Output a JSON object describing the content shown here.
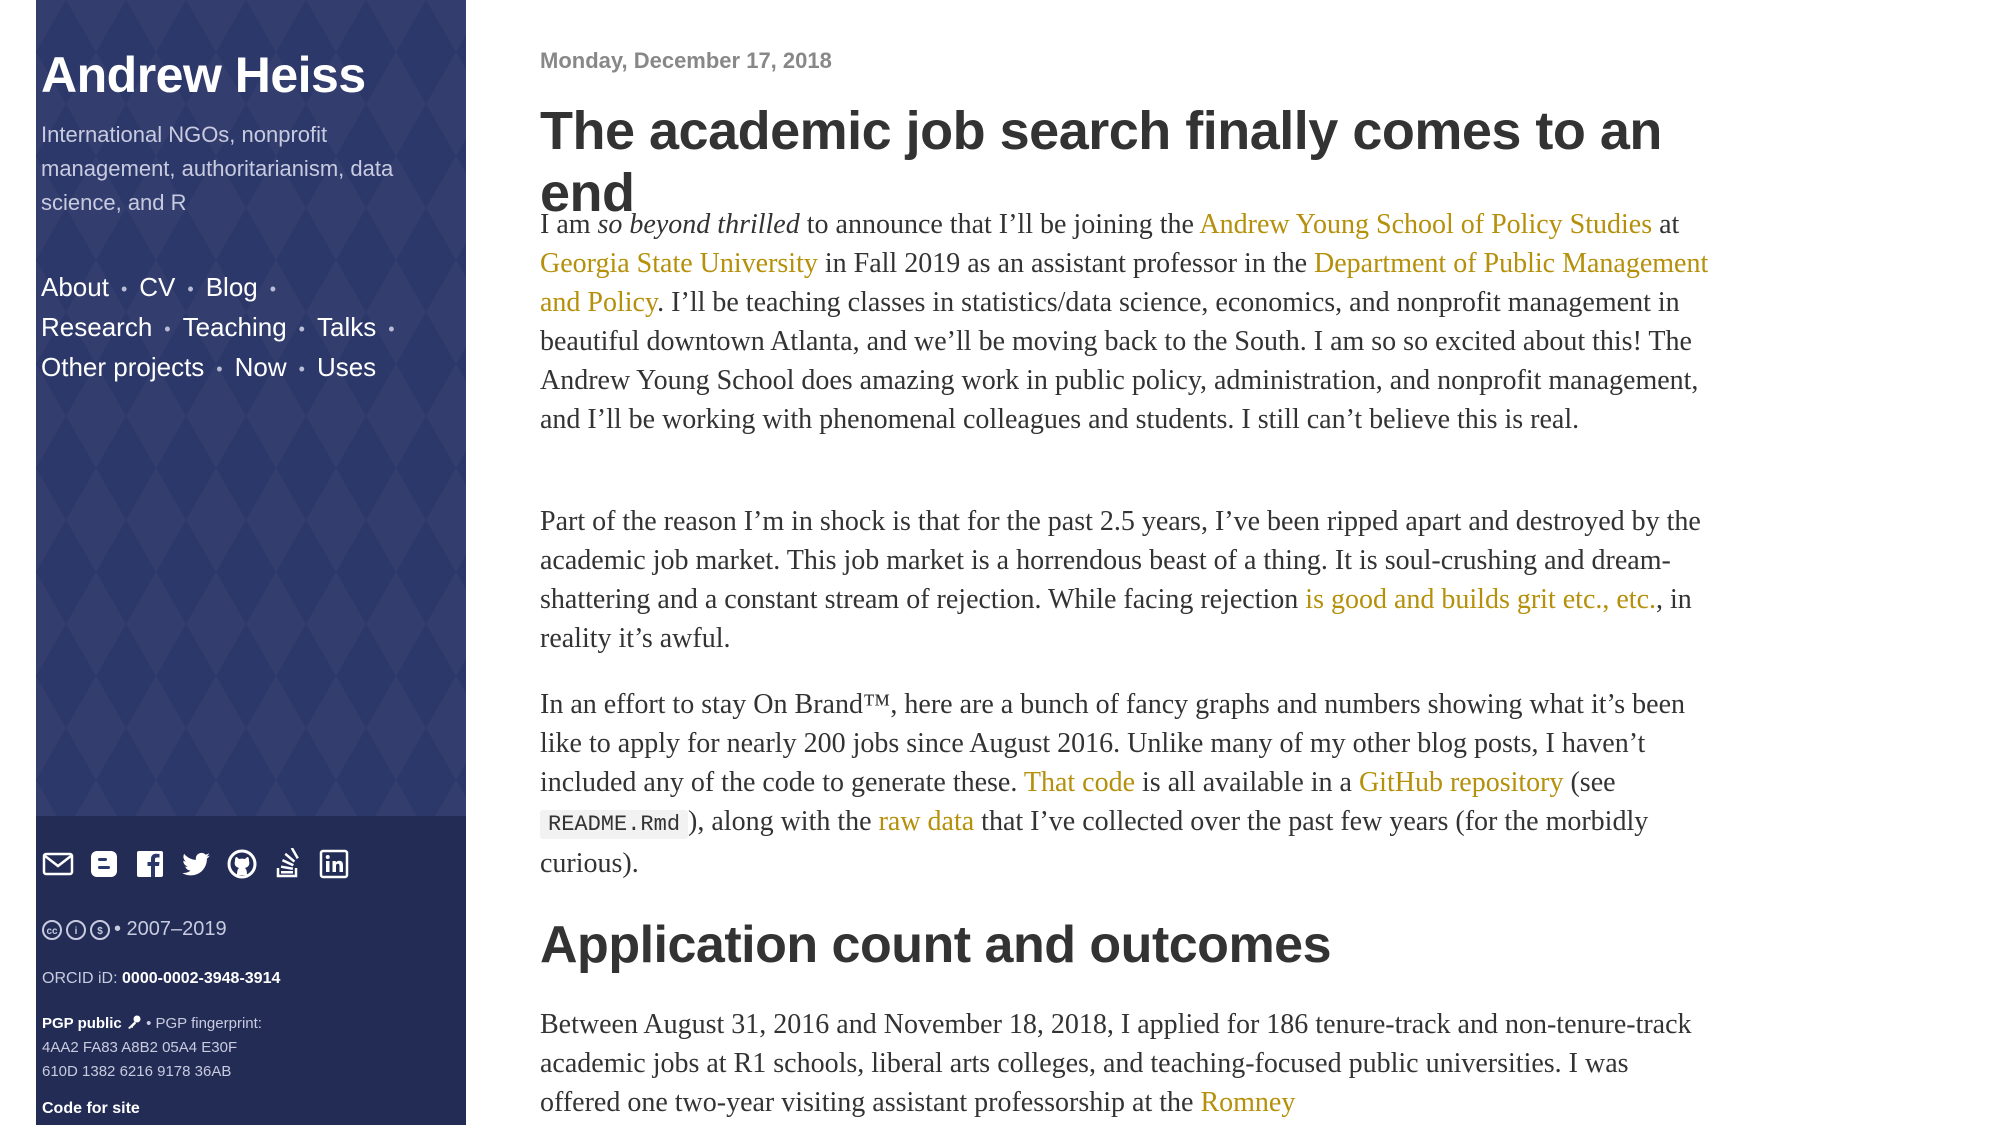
{
  "sidebar": {
    "title": "Andrew Heiss",
    "tagline": "International NGOs, nonprofit management, authoritarianism, data science, and R",
    "nav": [
      "About",
      "CV",
      "Blog",
      "Research",
      "Teaching",
      "Talks",
      "Other projects",
      "Now",
      "Uses"
    ],
    "nav_separator": "•",
    "social_icons": [
      "email-icon",
      "blogger-icon",
      "facebook-icon",
      "twitter-icon",
      "github-icon",
      "stackoverflow-icon",
      "linkedin-icon"
    ],
    "license_text": "• 2007–2019",
    "orcid_label": "ORCID iD:",
    "orcid_value": "0000-0002-3948-3914",
    "pgp_public": "PGP public",
    "pgp_fingerprint_label": "• PGP fingerprint:",
    "pgp_fingerprint_line1": "4AA2 FA83 A8B2 05A4 E30F",
    "pgp_fingerprint_line2": "610D 1382 6216 9178 36AB",
    "code_link": "Code for site"
  },
  "post": {
    "date": "Monday, December 17, 2018",
    "title": "The academic job search finally comes to an end",
    "p1": {
      "t1": "I am ",
      "em": "so beyond thrilled",
      "t2": " to announce that I’ll be joining the ",
      "l1": "Andrew Young School of Policy Studies",
      "t3": " at ",
      "l2": "Georgia State University",
      "t4": " in Fall 2019 as an assistant professor in the ",
      "l3": "Department of Public Management and Policy",
      "t5": ". I’ll be teaching classes in statistics/data science, economics, and nonprofit management in beautiful downtown Atlanta, and we’ll be moving back to the South. I am so so excited about this! The Andrew Young School does amazing work in public policy, administration, and nonprofit management, and I’ll be working with phenomenal colleagues and students. I still can’t believe this is real."
    },
    "p2": {
      "t1": "Part of the reason I’m in shock is that for the past 2.5 years, I’ve been ripped apart and destroyed by the academic job market. This job market is a horrendous beast of a thing. It is soul-crushing and dream-shattering and a constant stream of rejection. While facing rejection ",
      "l1": "is good and builds grit etc., etc.",
      "t2": ", in reality it’s awful."
    },
    "p3": {
      "t1": "In an effort to stay On Brand™, here are a bunch of fancy graphs and numbers showing what it’s been like to apply for nearly 200 jobs since August 2016. Unlike many of my other blog posts, I haven’t included any of the code to generate these. ",
      "l1": "That code",
      "t2": " is all available in a ",
      "l2": "GitHub repository",
      "t3": " (see ",
      "code": "README.Rmd",
      "t4": "), along with the ",
      "l3": "raw data",
      "t5": " that I’ve collected over the past few years (for the morbidly curious)."
    },
    "h2": "Application count and outcomes",
    "p4": {
      "t1": "Between August 31, 2016 and November 18, 2018, I applied for 186 tenure-track and non-tenure-track academic jobs at R1 schools, liberal arts colleges, and teaching-focused public universities. I was offered one two-year visiting assistant professorship at the ",
      "l1": "Romney"
    }
  },
  "colors": {
    "sidebar_bg": "#2c3869",
    "sidebar_footer_bg": "#232c55",
    "link": "#b5900a",
    "text": "#333333"
  }
}
